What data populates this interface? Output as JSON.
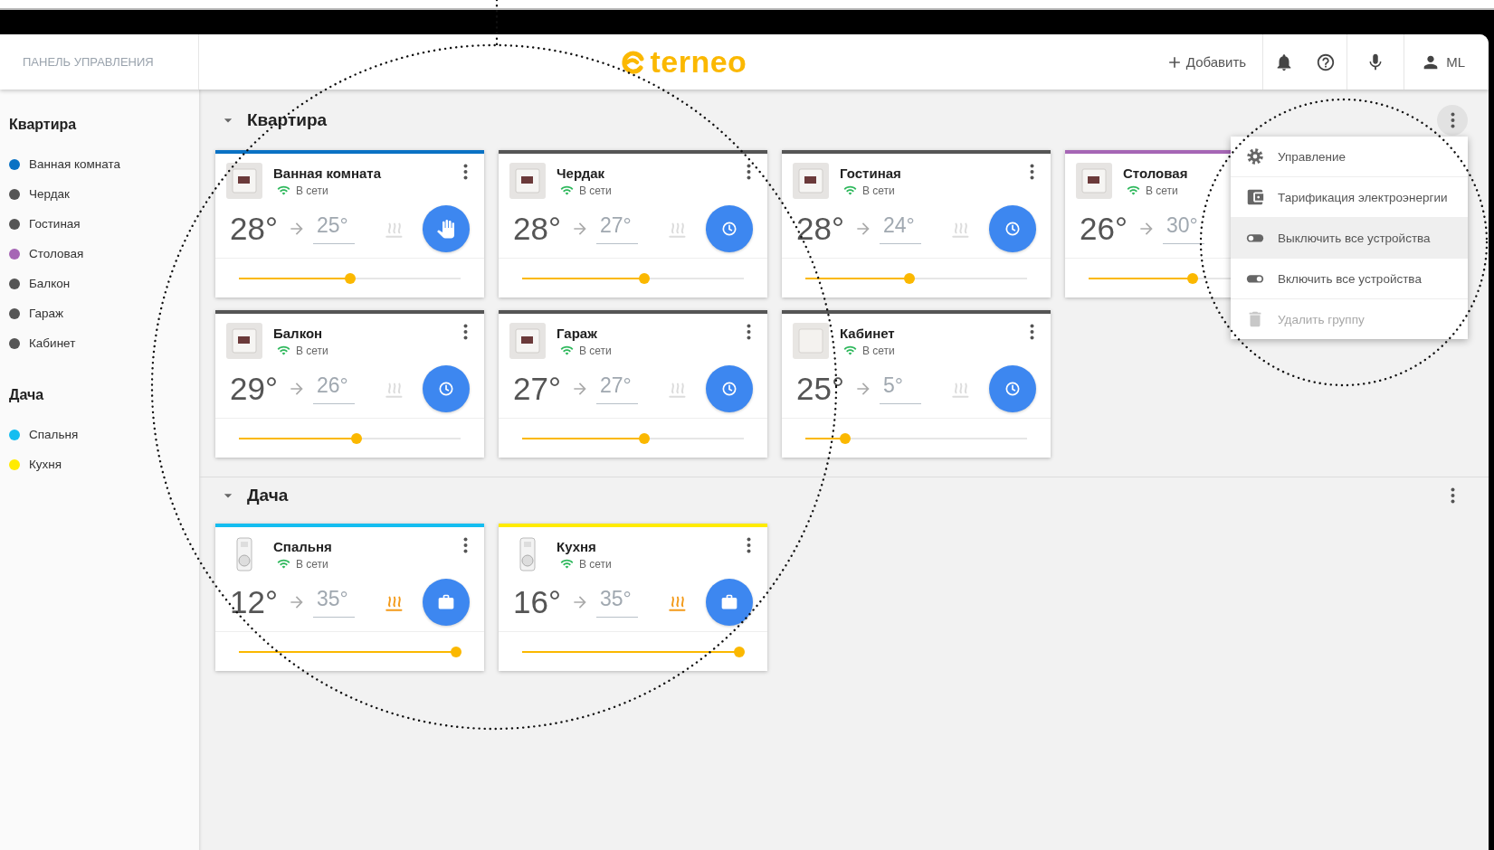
{
  "header": {
    "panel_title": "ПАНЕЛЬ УПРАВЛЕНИЯ",
    "logo": "terneo",
    "add_label": "Добавить",
    "user": "ML"
  },
  "sidebar": {
    "groups": [
      {
        "title": "Квартира",
        "items": [
          {
            "name": "Ванная комната",
            "color": "#0a72c4"
          },
          {
            "name": "Чердак",
            "color": "#555555"
          },
          {
            "name": "Гостиная",
            "color": "#555555"
          },
          {
            "name": "Столовая",
            "color": "#a666b5"
          },
          {
            "name": "Балкон",
            "color": "#555555"
          },
          {
            "name": "Гараж",
            "color": "#555555"
          },
          {
            "name": "Кабинет",
            "color": "#555555"
          }
        ]
      },
      {
        "title": "Дача",
        "items": [
          {
            "name": "Спальня",
            "color": "#14bdf0"
          },
          {
            "name": "Кухня",
            "color": "#ffeb00"
          }
        ]
      }
    ]
  },
  "groups": [
    {
      "title": "Квартира",
      "expanded": true,
      "menu_active": true,
      "cards": [
        {
          "name": "Ванная комната",
          "color": "#0a72c4",
          "device": {
            "kind": "display"
          },
          "status": "В сети",
          "current": "28°",
          "target": "25°",
          "heating": false,
          "mode_button": {
            "kind": "manual"
          },
          "level": 0.5,
          "more_button": true
        },
        {
          "name": "Чердак",
          "color": "#555555",
          "device": {
            "kind": "display"
          },
          "status": "В сети",
          "current": "28°",
          "target": "27°",
          "heating": false,
          "mode_button": {
            "kind": "schedule"
          },
          "level": 0.55,
          "more_button": true
        },
        {
          "name": "Гостиная",
          "color": "#555555",
          "device": {
            "kind": "display"
          },
          "status": "В сети",
          "current": "28°",
          "target": "24°",
          "heating": false,
          "mode_button": {
            "kind": "schedule"
          },
          "level": 0.47,
          "more_button": true
        },
        {
          "name": "Столовая",
          "color": "#a666b5",
          "device": {
            "kind": "display"
          },
          "status": "В сети",
          "current": "26°",
          "target": "30°",
          "level": 0.47,
          "more_button": false
        },
        {
          "name": "Балкон",
          "color": "#555555",
          "device": {
            "kind": "display"
          },
          "status": "В сети",
          "current": "29°",
          "target": "26°",
          "heating": false,
          "mode_button": {
            "kind": "schedule"
          },
          "level": 0.53,
          "more_button": true
        },
        {
          "name": "Гараж",
          "color": "#555555",
          "device": {
            "kind": "display"
          },
          "status": "В сети",
          "current": "27°",
          "target": "27°",
          "heating": false,
          "mode_button": {
            "kind": "schedule"
          },
          "level": 0.55,
          "more_button": true
        },
        {
          "name": "Кабинет",
          "color": "#555555",
          "device": {
            "kind": "blank"
          },
          "status": "В сети",
          "current": "25°",
          "target": "5°",
          "heating": false,
          "mode_button": {
            "kind": "schedule"
          },
          "level": 0.18,
          "more_button": true
        }
      ]
    },
    {
      "title": "Дача",
      "expanded": true,
      "menu_active": false,
      "cards": [
        {
          "name": "Спальня",
          "color": "#14bdf0",
          "device": {
            "kind": "plug"
          },
          "status": "В сети",
          "current": "12°",
          "target": "35°",
          "heating": true,
          "mode_button": {
            "kind": "away"
          },
          "level": 0.98,
          "more_button": true
        },
        {
          "name": "Кухня",
          "color": "#ffeb00",
          "device": {
            "kind": "plug"
          },
          "status": "В сети",
          "current": "16°",
          "target": "35°",
          "heating": true,
          "mode_button": {
            "kind": "away"
          },
          "level": 0.98,
          "more_button": true
        }
      ]
    }
  ],
  "menu": {
    "items": [
      {
        "label": "Управление",
        "kind": "gear",
        "highlighted": false,
        "disabled": false
      },
      {
        "label": "Тарификация электроэнергии",
        "kind": "wallet",
        "highlighted": false,
        "disabled": false
      },
      {
        "label": "Выключить все устройства",
        "kind": "toggle-off",
        "highlighted": true,
        "disabled": false
      },
      {
        "label": "Включить все устройства",
        "kind": "toggle-on",
        "highlighted": false,
        "disabled": false
      },
      {
        "label": "Удалить группу",
        "kind": "trash",
        "highlighted": false,
        "disabled": true
      }
    ]
  }
}
